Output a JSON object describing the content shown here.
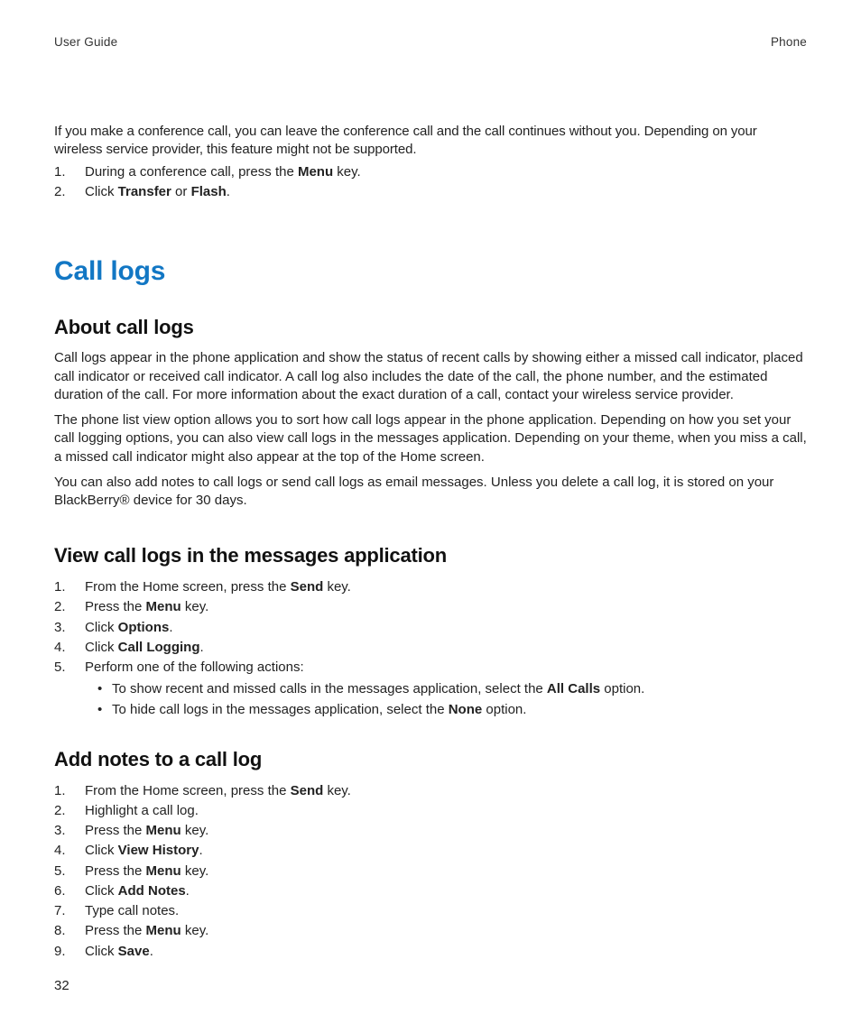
{
  "header": {
    "left": "User Guide",
    "right": "Phone"
  },
  "intro": {
    "para": "If you make a conference call, you can leave the conference call and the call continues without you. Depending on your wireless service provider, this feature might not be supported.",
    "steps": [
      {
        "n": "1.",
        "pre": "During a conference call, press the ",
        "b1": "Menu",
        "post": " key."
      },
      {
        "n": "2.",
        "pre": "Click ",
        "b1": "Transfer",
        "mid": " or ",
        "b2": "Flash",
        "post": "."
      }
    ]
  },
  "section_title": "Call logs",
  "about": {
    "title": "About call logs",
    "p1": "Call logs appear in the phone application and show the status of recent calls by showing either a missed call indicator, placed call indicator or received call indicator. A call log also includes the date of the call, the phone number, and the estimated duration of the call. For more information about the exact duration of a call, contact your wireless service provider.",
    "p2": "The phone list view option allows you to sort how call logs appear in the phone application. Depending on how you set your call logging options, you can also view call logs in the messages application. Depending on your theme, when you miss a call, a missed call indicator might also appear at the top of the Home screen.",
    "p3": "You can also add notes to call logs or send call logs as email messages. Unless you delete a call log, it is stored on your BlackBerry® device for 30 days."
  },
  "view": {
    "title": "View call logs in the messages application",
    "steps": {
      "s1": {
        "n": "1.",
        "pre": "From the Home screen, press the ",
        "b": "Send",
        "post": " key."
      },
      "s2": {
        "n": "2.",
        "pre": "Press the ",
        "b": "Menu",
        "post": " key."
      },
      "s3": {
        "n": "3.",
        "pre": "Click ",
        "b": "Options",
        "post": "."
      },
      "s4": {
        "n": "4.",
        "pre": "Click ",
        "b": "Call Logging",
        "post": "."
      },
      "s5": {
        "n": "5.",
        "text": "Perform one of the following actions:"
      }
    },
    "bullets": {
      "b1": {
        "pre": "To show recent and missed calls in the messages application, select the ",
        "b": "All Calls",
        "post": " option."
      },
      "b2": {
        "pre": "To hide call logs in the messages application, select the ",
        "b": "None",
        "post": " option."
      }
    }
  },
  "addnotes": {
    "title": "Add notes to a call log",
    "steps": {
      "s1": {
        "n": "1.",
        "pre": "From the Home screen, press the ",
        "b": "Send",
        "post": " key."
      },
      "s2": {
        "n": "2.",
        "text": "Highlight a call log."
      },
      "s3": {
        "n": "3.",
        "pre": "Press the ",
        "b": "Menu",
        "post": " key."
      },
      "s4": {
        "n": "4.",
        "pre": "Click ",
        "b": "View History",
        "post": "."
      },
      "s5": {
        "n": "5.",
        "pre": "Press the ",
        "b": "Menu",
        "post": " key."
      },
      "s6": {
        "n": "6.",
        "pre": "Click ",
        "b": "Add Notes",
        "post": "."
      },
      "s7": {
        "n": "7.",
        "text": "Type call notes."
      },
      "s8": {
        "n": "8.",
        "pre": "Press the ",
        "b": "Menu",
        "post": " key."
      },
      "s9": {
        "n": "9.",
        "pre": "Click ",
        "b": "Save",
        "post": "."
      }
    }
  },
  "page_number": "32"
}
